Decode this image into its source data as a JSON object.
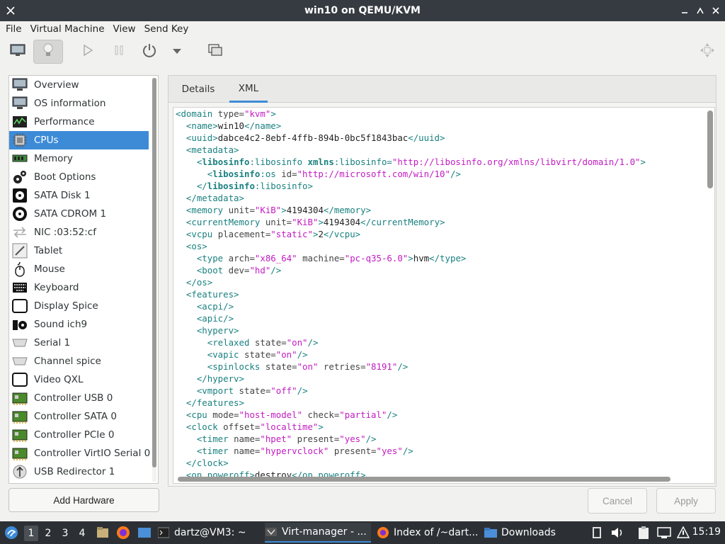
{
  "window": {
    "title": "win10 on QEMU/KVM"
  },
  "menu": [
    "File",
    "Virtual Machine",
    "View",
    "Send Key"
  ],
  "sidebar": {
    "items": [
      {
        "label": "Overview",
        "icon": "monitor-icon"
      },
      {
        "label": "OS information",
        "icon": "monitor-icon"
      },
      {
        "label": "Performance",
        "icon": "performance-icon"
      },
      {
        "label": "CPUs",
        "icon": "cpu-icon",
        "selected": true
      },
      {
        "label": "Memory",
        "icon": "memory-icon"
      },
      {
        "label": "Boot Options",
        "icon": "gears-icon"
      },
      {
        "label": "SATA Disk 1",
        "icon": "disk-icon"
      },
      {
        "label": "SATA CDROM 1",
        "icon": "cdrom-icon"
      },
      {
        "label": "NIC :03:52:cf",
        "icon": "network-arrows-icon"
      },
      {
        "label": "Tablet",
        "icon": "tablet-icon"
      },
      {
        "label": "Mouse",
        "icon": "mouse-icon"
      },
      {
        "label": "Keyboard",
        "icon": "keyboard-icon"
      },
      {
        "label": "Display Spice",
        "icon": "display-icon"
      },
      {
        "label": "Sound ich9",
        "icon": "sound-icon"
      },
      {
        "label": "Serial 1",
        "icon": "serial-icon"
      },
      {
        "label": "Channel spice",
        "icon": "channel-icon"
      },
      {
        "label": "Video QXL",
        "icon": "video-icon"
      },
      {
        "label": "Controller USB 0",
        "icon": "pci-card-icon"
      },
      {
        "label": "Controller SATA 0",
        "icon": "pci-card-icon"
      },
      {
        "label": "Controller PCIe 0",
        "icon": "pci-card-icon"
      },
      {
        "label": "Controller VirtIO Serial 0",
        "icon": "pci-card-icon"
      },
      {
        "label": "USB Redirector 1",
        "icon": "usb-redirect-icon"
      }
    ],
    "add_hardware": "Add Hardware"
  },
  "tabs": [
    {
      "label": "Details",
      "active": false
    },
    {
      "label": "XML",
      "active": true
    }
  ],
  "xml_lines": [
    [
      [
        "t",
        "<domain "
      ],
      [
        "a",
        "type="
      ],
      [
        "v",
        "\"kvm\""
      ],
      [
        "t",
        ">"
      ]
    ],
    [
      [
        "t",
        "  <name>"
      ],
      [
        "txt",
        "win10"
      ],
      [
        "t",
        "</name>"
      ]
    ],
    [
      [
        "t",
        "  <uuid>"
      ],
      [
        "txt",
        "dabce4c2-8ebf-4ffb-894b-0bc5f1843bac"
      ],
      [
        "t",
        "</uuid>"
      ]
    ],
    [
      [
        "t",
        "  <metadata>"
      ]
    ],
    [
      [
        "t",
        "    <"
      ],
      [
        "b",
        "libosinfo"
      ],
      [
        "t",
        ":libosinfo "
      ],
      [
        "b",
        "xmlns"
      ],
      [
        "t",
        ":libosinfo="
      ],
      [
        "v",
        "\"http://libosinfo.org/xmlns/libvirt/domain/1.0\""
      ],
      [
        "t",
        ">"
      ]
    ],
    [
      [
        "t",
        "      <"
      ],
      [
        "b",
        "libosinfo"
      ],
      [
        "t",
        ":os "
      ],
      [
        "a",
        "id="
      ],
      [
        "v",
        "\"http://microsoft.com/win/10\""
      ],
      [
        "t",
        "/>"
      ]
    ],
    [
      [
        "t",
        "    </"
      ],
      [
        "b",
        "libosinfo"
      ],
      [
        "t",
        ":libosinfo>"
      ]
    ],
    [
      [
        "t",
        "  </metadata>"
      ]
    ],
    [
      [
        "t",
        "  <memory "
      ],
      [
        "a",
        "unit="
      ],
      [
        "v",
        "\"KiB\""
      ],
      [
        "t",
        ">"
      ],
      [
        "txt",
        "4194304"
      ],
      [
        "t",
        "</memory>"
      ]
    ],
    [
      [
        "t",
        "  <currentMemory "
      ],
      [
        "a",
        "unit="
      ],
      [
        "v",
        "\"KiB\""
      ],
      [
        "t",
        ">"
      ],
      [
        "txt",
        "4194304"
      ],
      [
        "t",
        "</currentMemory>"
      ]
    ],
    [
      [
        "t",
        "  <vcpu "
      ],
      [
        "a",
        "placement="
      ],
      [
        "v",
        "\"static\""
      ],
      [
        "t",
        ">"
      ],
      [
        "txt",
        "2"
      ],
      [
        "t",
        "</vcpu>"
      ]
    ],
    [
      [
        "t",
        "  <os>"
      ]
    ],
    [
      [
        "t",
        "    <type "
      ],
      [
        "a",
        "arch="
      ],
      [
        "v",
        "\"x86_64\""
      ],
      [
        "a",
        " machine="
      ],
      [
        "v",
        "\"pc-q35-6.0\""
      ],
      [
        "t",
        ">"
      ],
      [
        "txt",
        "hvm"
      ],
      [
        "t",
        "</type>"
      ]
    ],
    [
      [
        "t",
        "    <boot "
      ],
      [
        "a",
        "dev="
      ],
      [
        "v",
        "\"hd\""
      ],
      [
        "t",
        "/>"
      ]
    ],
    [
      [
        "t",
        "  </os>"
      ]
    ],
    [
      [
        "t",
        "  <features>"
      ]
    ],
    [
      [
        "t",
        "    <acpi/>"
      ]
    ],
    [
      [
        "t",
        "    <apic/>"
      ]
    ],
    [
      [
        "t",
        "    <hyperv>"
      ]
    ],
    [
      [
        "t",
        "      <relaxed "
      ],
      [
        "a",
        "state="
      ],
      [
        "v",
        "\"on\""
      ],
      [
        "t",
        "/>"
      ]
    ],
    [
      [
        "t",
        "      <vapic "
      ],
      [
        "a",
        "state="
      ],
      [
        "v",
        "\"on\""
      ],
      [
        "t",
        "/>"
      ]
    ],
    [
      [
        "t",
        "      <spinlocks "
      ],
      [
        "a",
        "state="
      ],
      [
        "v",
        "\"on\""
      ],
      [
        "a",
        " retries="
      ],
      [
        "v",
        "\"8191\""
      ],
      [
        "t",
        "/>"
      ]
    ],
    [
      [
        "t",
        "    </hyperv>"
      ]
    ],
    [
      [
        "t",
        "    <vmport "
      ],
      [
        "a",
        "state="
      ],
      [
        "v",
        "\"off\""
      ],
      [
        "t",
        "/>"
      ]
    ],
    [
      [
        "t",
        "  </features>"
      ]
    ],
    [
      [
        "t",
        "  <cpu "
      ],
      [
        "a",
        "mode="
      ],
      [
        "v",
        "\"host-model\""
      ],
      [
        "a",
        " check="
      ],
      [
        "v",
        "\"partial\""
      ],
      [
        "t",
        "/>"
      ]
    ],
    [
      [
        "t",
        "  <clock "
      ],
      [
        "a",
        "offset="
      ],
      [
        "v",
        "\"localtime\""
      ],
      [
        "t",
        ">"
      ]
    ],
    [
      [
        "t",
        "    <timer "
      ],
      [
        "a",
        "name="
      ],
      [
        "v",
        "\"hpet\""
      ],
      [
        "a",
        " present="
      ],
      [
        "v",
        "\"yes\""
      ],
      [
        "t",
        "/>"
      ]
    ],
    [
      [
        "t",
        "    <timer "
      ],
      [
        "a",
        "name="
      ],
      [
        "v",
        "\"hypervclock\""
      ],
      [
        "a",
        " present="
      ],
      [
        "v",
        "\"yes\""
      ],
      [
        "t",
        "/>"
      ]
    ],
    [
      [
        "t",
        "  </clock>"
      ]
    ],
    [
      [
        "t",
        "  <on_poweroff>"
      ],
      [
        "txt",
        "destroy"
      ],
      [
        "t",
        "</on_poweroff>"
      ]
    ]
  ],
  "buttons": {
    "cancel": "Cancel",
    "apply": "Apply"
  },
  "taskbar": {
    "workspaces": [
      "1",
      "2",
      "3",
      "4"
    ],
    "tasks": [
      {
        "label": "dartz@VM3: ~",
        "icon": "terminal-icon"
      },
      {
        "label": "Virt-manager - ...",
        "icon": "virt-manager-icon",
        "active": true
      },
      {
        "label": "Index of /~dart...",
        "icon": "firefox-icon"
      },
      {
        "label": "Downloads",
        "icon": "folder-icon"
      }
    ],
    "clock": "15:19"
  },
  "colors": {
    "selection": "#3d8bd7",
    "xml_tag": "#1a8080",
    "xml_value": "#c21bc2"
  }
}
